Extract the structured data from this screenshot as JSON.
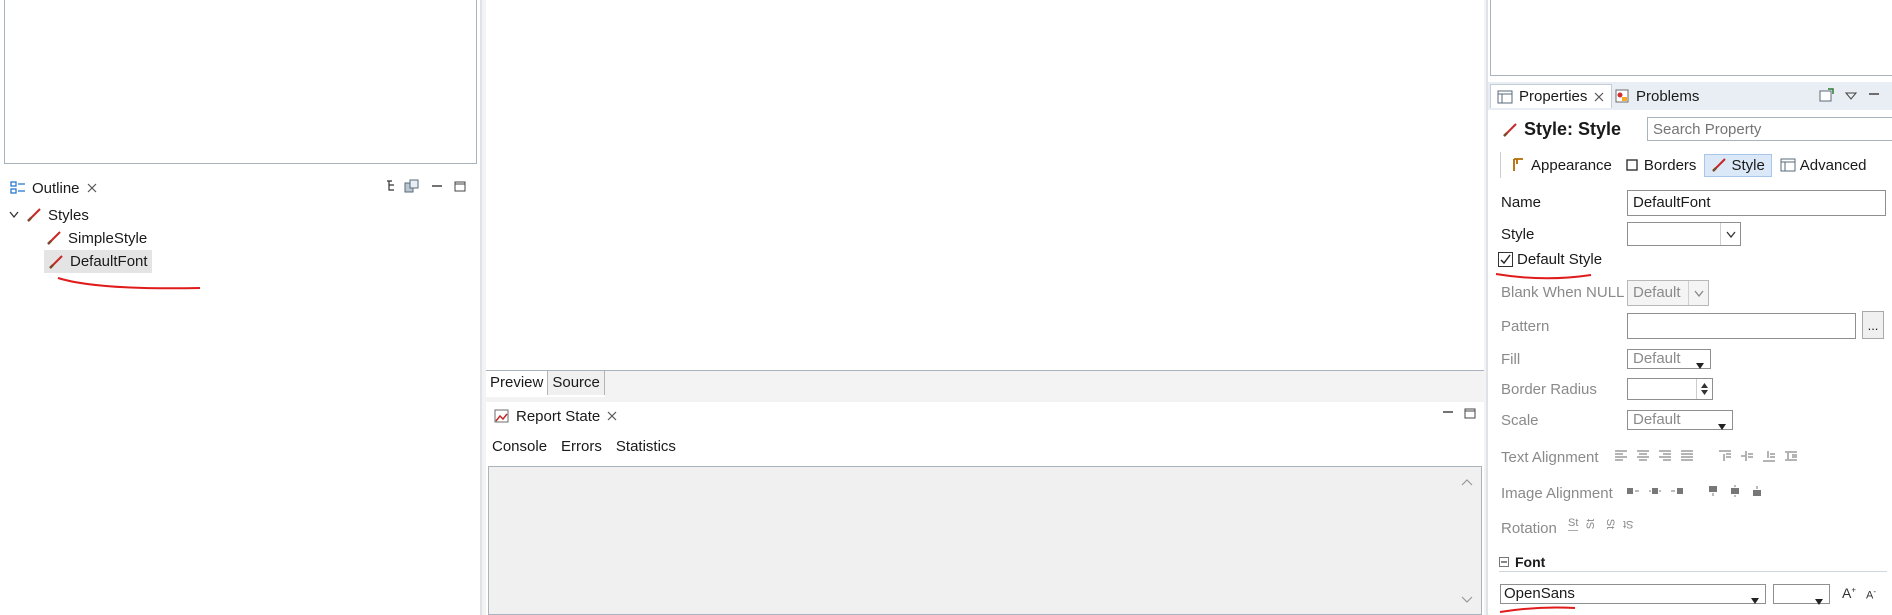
{
  "outline": {
    "tab_label": "Outline",
    "tree": {
      "root_label": "Styles",
      "items": [
        "SimpleStyle",
        "DefaultFont"
      ]
    }
  },
  "editor": {
    "tabs": [
      "Preview",
      "Source"
    ]
  },
  "report_state": {
    "tab_label": "Report State",
    "subtabs": [
      "Console",
      "Errors",
      "Statistics"
    ]
  },
  "properties": {
    "tabs": [
      "Properties",
      "Problems"
    ],
    "title": "Style: Style",
    "search_placeholder": "Search Property",
    "categories": [
      "Appearance",
      "Borders",
      "Style",
      "Advanced"
    ],
    "active_category": "Style",
    "rows": {
      "name_label": "Name",
      "name_value": "DefaultFont",
      "style_label": "Style",
      "style_value": "",
      "default_style_label": "Default Style",
      "default_style_checked": true,
      "blank_when_null_label": "Blank When NULL",
      "blank_when_null_value": "Default",
      "pattern_label": "Pattern",
      "pattern_value": "",
      "pattern_button": "...",
      "fill_label": "Fill",
      "fill_value": "Default",
      "border_radius_label": "Border Radius",
      "border_radius_value": "",
      "scale_label": "Scale",
      "scale_value": "Default",
      "text_alignment_label": "Text Alignment",
      "image_alignment_label": "Image Alignment",
      "rotation_label": "Rotation"
    },
    "font_section": {
      "title": "Font",
      "font_name": "OpenSans",
      "font_size": ""
    }
  },
  "colors": {
    "accent": "#2a78d1",
    "annotation": "#e01b1b",
    "selection": "#e4e4e4",
    "tab_selected": "#dbe8f7"
  }
}
